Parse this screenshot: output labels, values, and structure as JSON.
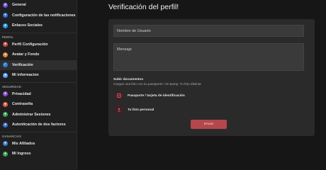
{
  "sidebar": {
    "groups": [
      {
        "label": "",
        "items": [
          {
            "label": "General",
            "icon": "gear-icon",
            "color": "#6a4bd6",
            "glyph": "⚙"
          },
          {
            "label": "Configuración de las notificaciones",
            "icon": "bell-icon",
            "color": "#2f6fd8",
            "glyph": "●"
          },
          {
            "label": "Enlaces Sociales",
            "icon": "twitter-icon",
            "color": "#1d9bf0",
            "glyph": "●"
          }
        ]
      },
      {
        "label": "PERFIL",
        "items": [
          {
            "label": "Perfil Configuración",
            "icon": "profile-icon",
            "color": "#d14b4b",
            "glyph": "●"
          },
          {
            "label": "Avatar y Fondo",
            "icon": "image-icon",
            "color": "#e08a2b",
            "glyph": "●"
          },
          {
            "label": "Verificación",
            "icon": "verified-icon",
            "color": "#2f80d8",
            "glyph": "✓",
            "active": true
          },
          {
            "label": "Mi informacion",
            "icon": "info-icon",
            "color": "#5aa0ff",
            "glyph": "●"
          }
        ]
      },
      {
        "label": "SEGURIDAD",
        "items": [
          {
            "label": "Privacidad",
            "icon": "shield-icon",
            "color": "#8b4fd1",
            "glyph": "●"
          },
          {
            "label": "Contraseña",
            "icon": "key-icon",
            "color": "#e05a4a",
            "glyph": "●"
          },
          {
            "label": "Administrar Sesiones",
            "icon": "sessions-icon",
            "color": "#3aa35a",
            "glyph": "●"
          },
          {
            "label": "Autenticación de dos factores",
            "icon": "lock-icon",
            "color": "#3a6fd8",
            "glyph": "●"
          }
        ]
      },
      {
        "label": "GANANCIAS",
        "items": [
          {
            "label": "Mis Afiliados",
            "icon": "affiliates-icon",
            "color": "#3f7fd8",
            "glyph": "●"
          },
          {
            "label": "Mi Ingreso",
            "icon": "money-icon",
            "color": "#3aa35a",
            "glyph": "●"
          }
        ]
      }
    ]
  },
  "main": {
    "title": "Verificación del perfil!",
    "form": {
      "username_placeholder": "Nombre de Usuario",
      "message_placeholder": "Mensaje",
      "docs_title": "Subir documentos",
      "docs_hint": "Cargue una foto con su pasaporte / ID &amp; Tu foto distinta",
      "passport_label": "Pasaporte / tarjeta de identificación",
      "photo_label": "Tu foto personal",
      "submit_label": "Enviar"
    }
  },
  "colors": {
    "accent": "#b3474d",
    "background": "#161616",
    "card": "#2a2a2a"
  }
}
